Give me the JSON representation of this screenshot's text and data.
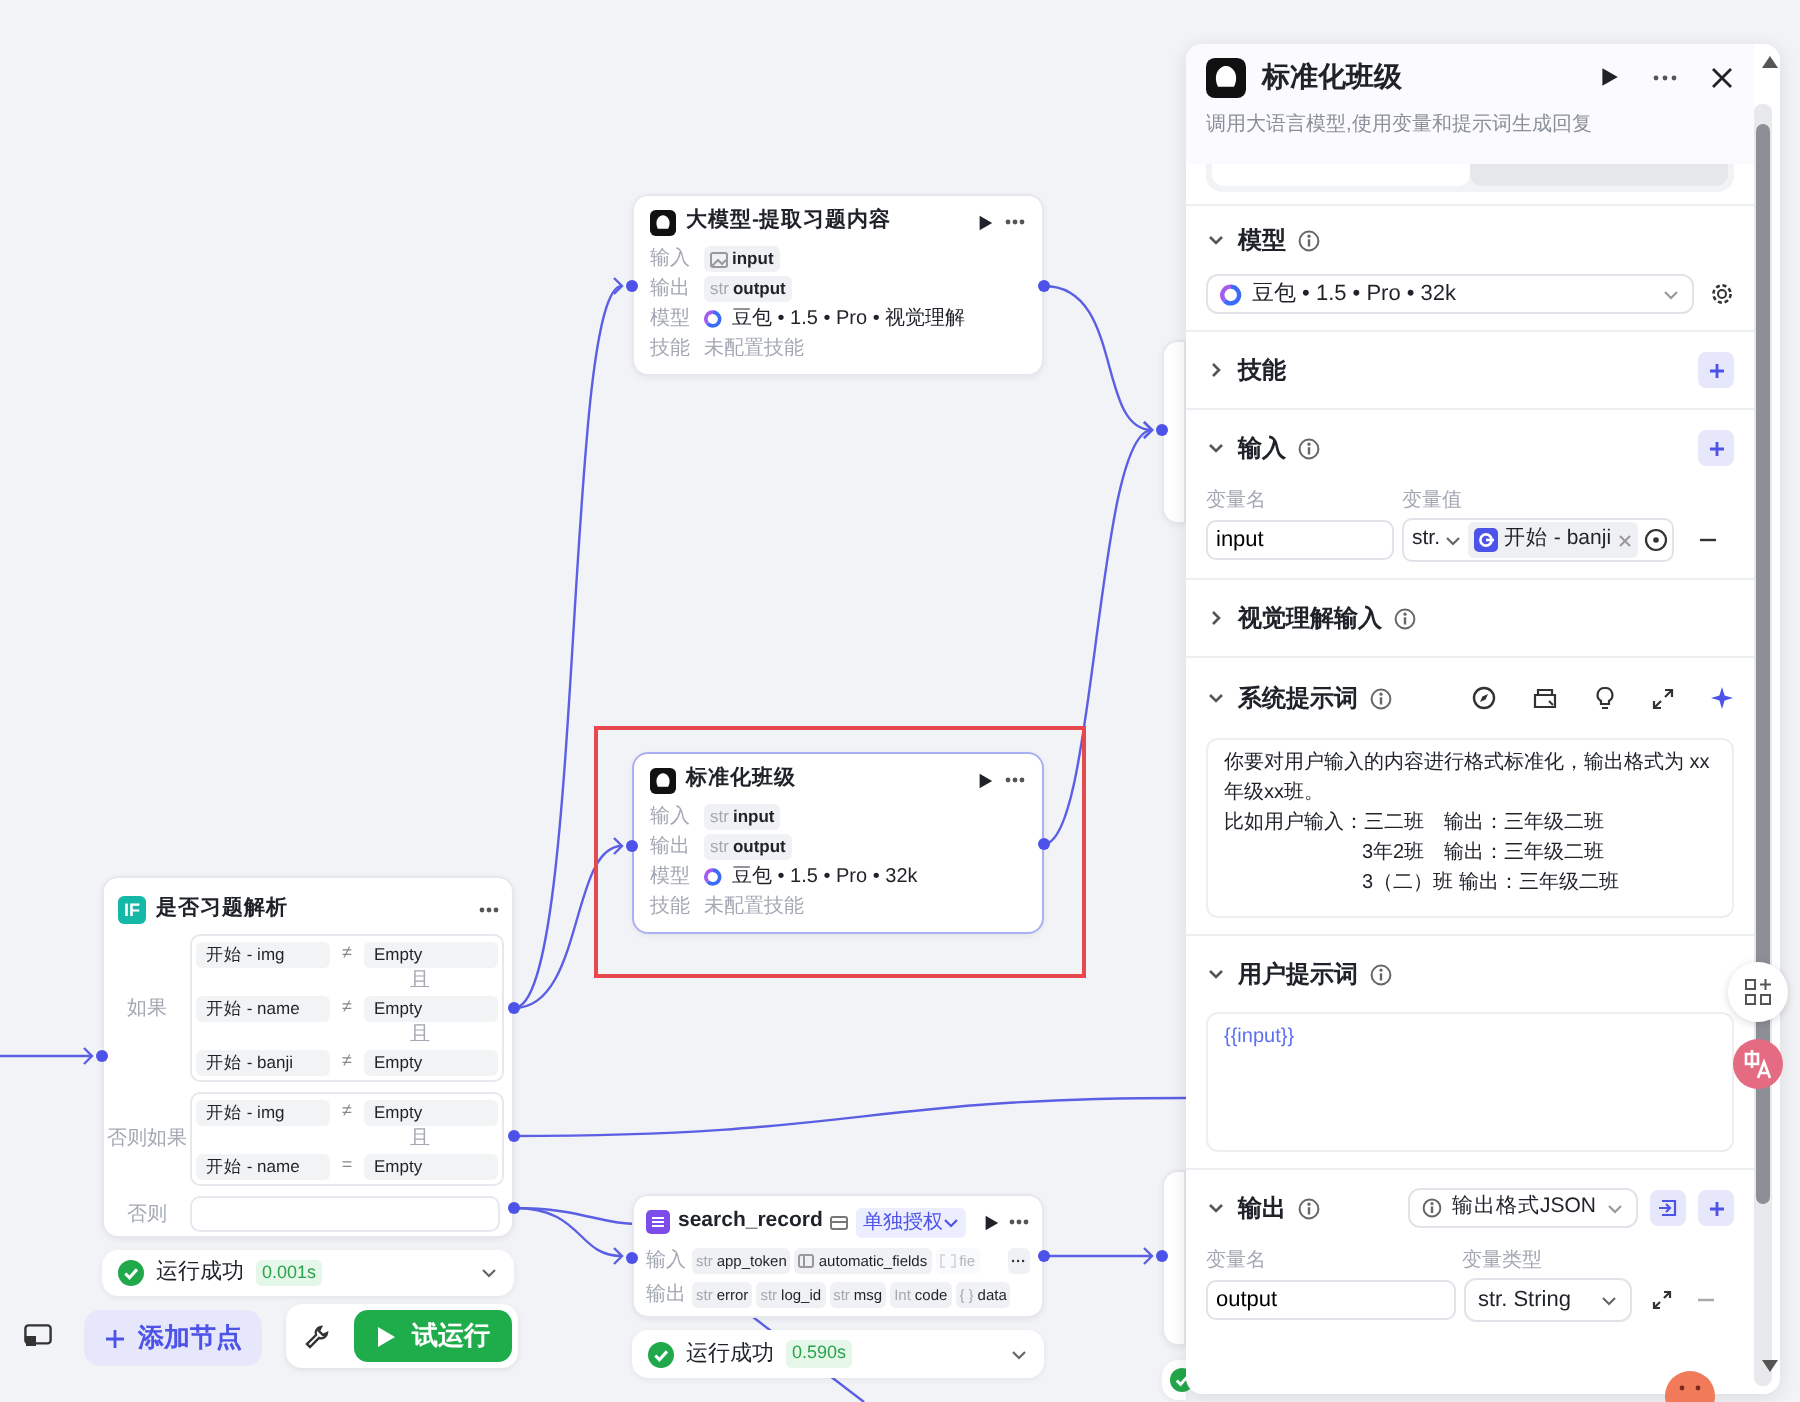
{
  "llm_nodes": [
    {
      "title": "大模型-提取习题内容",
      "selected": false,
      "highlighted": false,
      "rows": [
        {
          "kind": "tags",
          "label": "输入",
          "tags": [
            {
              "kind": "image",
              "name": "input"
            }
          ]
        },
        {
          "kind": "tags",
          "label": "输出",
          "tags": [
            {
              "prefix": "str",
              "name": "output"
            }
          ]
        },
        {
          "kind": "model",
          "label": "模型",
          "value": "豆包 • 1.5 • Pro • 视觉理解"
        },
        {
          "kind": "note",
          "label": "技能",
          "value": "未配置技能"
        }
      ]
    },
    {
      "title": "标准化班级",
      "selected": true,
      "highlighted": true,
      "rows": [
        {
          "kind": "tags",
          "label": "输入",
          "tags": [
            {
              "prefix": "str",
              "name": "input"
            }
          ]
        },
        {
          "kind": "tags",
          "label": "输出",
          "tags": [
            {
              "prefix": "str",
              "name": "output"
            }
          ]
        },
        {
          "kind": "model",
          "label": "模型",
          "value": "豆包 • 1.5 • Pro • 32k"
        },
        {
          "kind": "note",
          "label": "技能",
          "value": "未配置技能"
        }
      ]
    }
  ],
  "condition_node": {
    "icon": "IF",
    "title": "是否习题解析",
    "branches": [
      {
        "label": "如果",
        "rows": [
          {
            "kind": "condition",
            "left": "开始 - img",
            "op": "≠",
            "right": "Empty"
          },
          {
            "kind": "joiner",
            "text": "且"
          },
          {
            "kind": "condition",
            "left": "开始 - name",
            "op": "≠",
            "right": "Empty"
          },
          {
            "kind": "joiner",
            "text": "且"
          },
          {
            "kind": "condition",
            "left": "开始 - banji",
            "op": "≠",
            "right": "Empty"
          }
        ]
      },
      {
        "label": "否则如果",
        "rows": [
          {
            "kind": "condition",
            "left": "开始 - img",
            "op": "≠",
            "right": "Empty"
          },
          {
            "kind": "joiner",
            "text": "且"
          },
          {
            "kind": "condition",
            "left": "开始 - name",
            "op": "=",
            "right": "Empty"
          }
        ]
      },
      {
        "label": "否则"
      }
    ],
    "status": {
      "text": "运行成功",
      "time": "0.001s"
    }
  },
  "plugin_node": {
    "title": "search_record",
    "badge": "单独授权",
    "rows": [
      {
        "label": "输入",
        "tags": [
          {
            "prefix": "str",
            "name": "app_token"
          },
          {
            "kind": "fields",
            "name": "automatic_fields"
          },
          {
            "kind": "array",
            "name": "fie",
            "faded": true
          }
        ],
        "more": "···"
      },
      {
        "label": "输出",
        "tags": [
          {
            "prefix": "str",
            "name": "error"
          },
          {
            "prefix": "str",
            "name": "log_id"
          },
          {
            "prefix": "str",
            "name": "msg"
          },
          {
            "prefix": "Int",
            "name": "code"
          },
          {
            "prefix": "{ }",
            "name": "data"
          }
        ]
      }
    ],
    "status": {
      "text": "运行成功",
      "time": "0.590s"
    }
  },
  "toolbar": {
    "add_node": "添加节点",
    "test_run": "试运行"
  },
  "panel": {
    "title": "标准化班级",
    "subtitle": "调用大语言模型,使用变量和提示词生成回复",
    "mode_tabs": [
      {
        "selected": true
      },
      {
        "selected": false
      }
    ],
    "sections": [
      {
        "kind": "model",
        "title": "模型",
        "expanded": true,
        "info": true,
        "model": "豆包 • 1.5 • Pro • 32k"
      },
      {
        "kind": "skills",
        "title": "技能",
        "expanded": false,
        "info": false
      },
      {
        "kind": "input",
        "title": "输入",
        "expanded": true,
        "info": true,
        "columns": [
          "变量名",
          "变量值"
        ],
        "rows": [
          {
            "name": "input",
            "type": "str.",
            "ref": "开始 - banji"
          }
        ]
      },
      {
        "kind": "vision",
        "title": "视觉理解输入",
        "expanded": false,
        "info": true
      },
      {
        "kind": "system_prompt",
        "title": "系统提示词",
        "expanded": true,
        "info": true,
        "lines": [
          {
            "text": "你要对用户输入的内容进行格式标准化，输出格式为 xx年级xx班。",
            "indent": false
          },
          {
            "text": "比如用户输入：三二班　输出：三年级二班",
            "indent": false
          },
          {
            "text": "3年2班　输出：三年级二班",
            "indent": true
          },
          {
            "text": "3（二）班 输出：三年级二班",
            "indent": true
          }
        ]
      },
      {
        "kind": "user_prompt",
        "title": "用户提示词",
        "expanded": true,
        "info": true,
        "text": "{{input}}"
      },
      {
        "kind": "output",
        "title": "输出",
        "expanded": true,
        "info": true,
        "format": "输出格式JSON",
        "columns": [
          "变量名",
          "变量类型"
        ],
        "rows": [
          {
            "name": "output",
            "type": "str. String"
          }
        ]
      }
    ]
  }
}
